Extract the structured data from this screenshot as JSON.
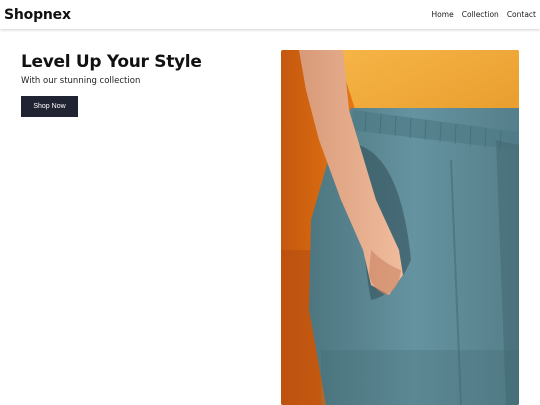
{
  "header": {
    "brand": "Shopnex",
    "nav": [
      {
        "label": "Home"
      },
      {
        "label": "Collection"
      },
      {
        "label": "Contact"
      }
    ]
  },
  "hero": {
    "title": "Level Up Your Style",
    "subtitle": "With our stunning collection",
    "cta_label": "Shop Now",
    "image_subject": "model in yellow top and blue-grey trousers, hand in pocket"
  },
  "colors": {
    "button_bg": "#202331",
    "button_text": "#ffffff",
    "shirt": "#f1aa3c",
    "trousers": "#5d8791",
    "background_orange": "#e8700f"
  }
}
